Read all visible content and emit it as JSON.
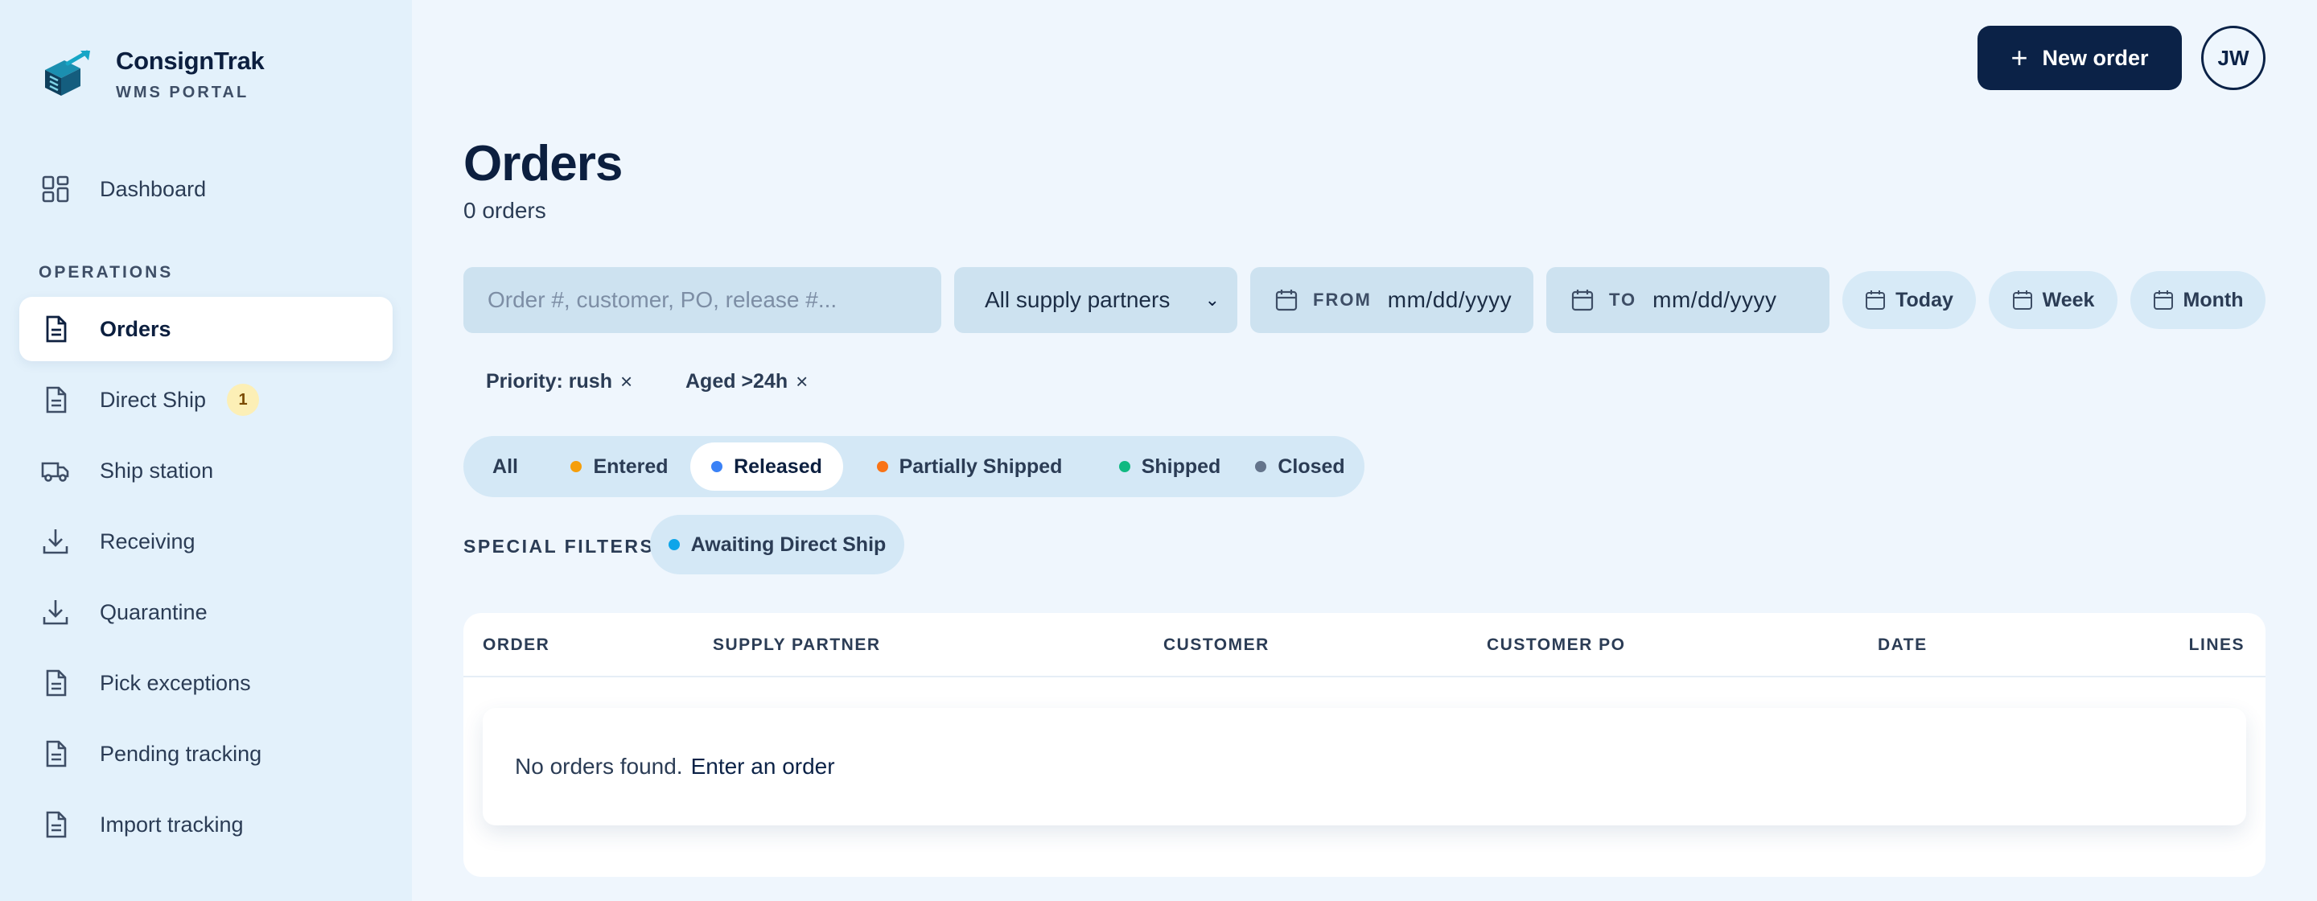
{
  "brand": {
    "name": "ConsignTrak",
    "subtitle": "WMS PORTAL"
  },
  "sidebar": {
    "dashboard_label": "Dashboard",
    "section_label": "OPERATIONS",
    "items": [
      {
        "label": "Orders",
        "icon": "document-icon",
        "active": true
      },
      {
        "label": "Direct Ship",
        "icon": "document-icon",
        "badge": "1"
      },
      {
        "label": "Ship station",
        "icon": "truck-icon"
      },
      {
        "label": "Receiving",
        "icon": "download-icon"
      },
      {
        "label": "Quarantine",
        "icon": "download-icon"
      },
      {
        "label": "Pick exceptions",
        "icon": "document-icon"
      },
      {
        "label": "Pending tracking",
        "icon": "document-icon"
      },
      {
        "label": "Import tracking",
        "icon": "document-icon"
      }
    ]
  },
  "header": {
    "new_order_label": "New order",
    "avatar_initials": "JW"
  },
  "page": {
    "title": "Orders",
    "count": "0 orders"
  },
  "filters": {
    "search_placeholder": "Order #, customer, PO, release #...",
    "partner_value": "All supply partners",
    "from_label": "FROM",
    "from_value": "mm/dd/yyyy",
    "to_label": "TO",
    "to_value": "mm/dd/yyyy",
    "ranges": [
      "Today",
      "Week",
      "Month"
    ],
    "active_pills": [
      "Priority: rush",
      "Aged >24h"
    ],
    "remove_glyph": "×"
  },
  "status_tabs": [
    {
      "label": "All",
      "dot": null
    },
    {
      "label": "Entered",
      "dot": "#f59e0b"
    },
    {
      "label": "Released",
      "dot": "#3b82f6",
      "active": true
    },
    {
      "label": "Partially Shipped",
      "dot": "#f97316"
    },
    {
      "label": "Shipped",
      "dot": "#10b981"
    },
    {
      "label": "Closed",
      "dot": "#64748b"
    }
  ],
  "special_filters": {
    "label": "SPECIAL FILTERS",
    "chip": "Awaiting Direct Ship",
    "chip_dot": "#0ea5e9"
  },
  "table": {
    "columns": [
      "ORDER",
      "SUPPLY PARTNER",
      "CUSTOMER",
      "CUSTOMER PO",
      "DATE",
      "LINES"
    ],
    "empty_text": "No orders found.",
    "empty_link": "Enter an order"
  }
}
